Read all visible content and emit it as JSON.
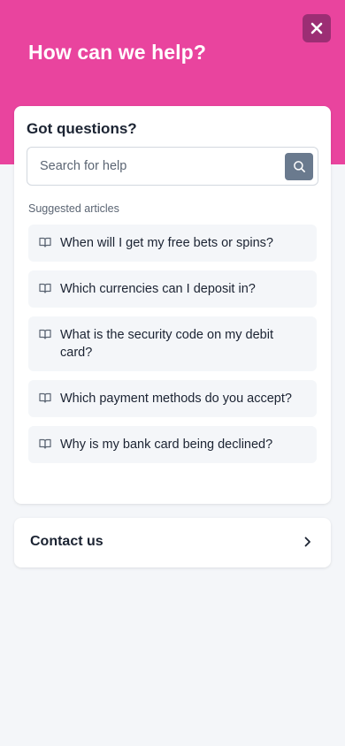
{
  "header": {
    "title": "How can we help?",
    "close_icon": "close-icon",
    "brand_color": "#e9449e"
  },
  "help_card": {
    "title": "Got questions?",
    "search": {
      "placeholder": "Search for help",
      "value": "",
      "button_icon": "search-icon"
    },
    "suggested_label": "Suggested articles",
    "articles": [
      {
        "icon": "book-icon",
        "label": "When will I get my free bets or spins?"
      },
      {
        "icon": "book-icon",
        "label": "Which currencies can I deposit in?"
      },
      {
        "icon": "book-icon",
        "label": "What is the security code on my debit card?"
      },
      {
        "icon": "book-icon",
        "label": "Which payment methods do you accept?"
      },
      {
        "icon": "book-icon",
        "label": "Why is my bank card being declined?"
      }
    ]
  },
  "contact": {
    "label": "Contact us",
    "icon": "chevron-right-icon"
  }
}
